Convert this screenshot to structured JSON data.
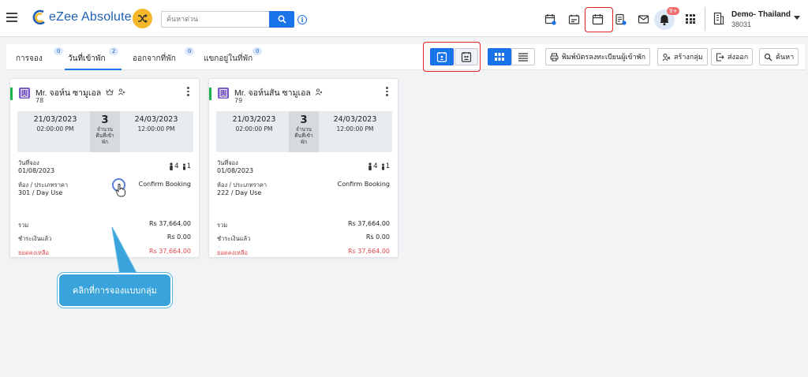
{
  "app": {
    "logo_text": "eZee Absolute"
  },
  "search": {
    "placeholder": "ค้นหาด่วน"
  },
  "notifications": {
    "badge": "9+"
  },
  "property": {
    "name": "Demo- Thailand",
    "code": "38031"
  },
  "tabs": [
    {
      "label": "การจอง",
      "count": "0"
    },
    {
      "label": "วันที่เข้าพัก",
      "count": "2"
    },
    {
      "label": "ออกจากที่พัก",
      "count": "0"
    },
    {
      "label": "แขกอยู่ในที่พัก",
      "count": "0"
    }
  ],
  "toolbar": {
    "print_registration": "พิมพ์บัตรลงทะเบียนผู้เข้าพัก",
    "create_group": "สร้างกลุ่ม",
    "export": "ส่งออก",
    "search": "ค้นหา"
  },
  "cards": [
    {
      "guest": "Mr. จอห์น ซามูเอล",
      "id": "78",
      "arrival_date": "21/03/2023",
      "arrival_time": "02:00:00 PM",
      "nights": "3",
      "nights_label_1": "จำนวน",
      "nights_label_2": "คืนที่เข้า",
      "nights_label_3": "พัก",
      "departure_date": "24/03/2023",
      "departure_time": "12:00:00 PM",
      "booking_date_label": "วันที่จอง",
      "booking_date": "01/08/2023",
      "adults": "4",
      "children": "1",
      "room_label": "ห้อง / ประเภทราคา",
      "room": "301 / Day Use",
      "status": "Confirm Booking",
      "total_label": "รวม",
      "total": "Rs 37,664.00",
      "paid_label": "ชำระเงินแล้ว",
      "paid": "Rs 0.00",
      "balance_label": "ยอดคงเหลือ",
      "balance": "Rs 37,664.00"
    },
    {
      "guest": "Mr. จอห์นสัน ซามูเอล",
      "id": "79",
      "arrival_date": "21/03/2023",
      "arrival_time": "02:00:00 PM",
      "nights": "3",
      "nights_label_1": "จำนวน",
      "nights_label_2": "คืนที่เข้า",
      "nights_label_3": "พัก",
      "departure_date": "24/03/2023",
      "departure_time": "12:00:00 PM",
      "booking_date_label": "วันที่จอง",
      "booking_date": "01/08/2023",
      "adults": "4",
      "children": "1",
      "room_label": "ห้อง / ประเภทราคา",
      "room": "222 / Day Use",
      "status": "Confirm Booking",
      "total_label": "รวม",
      "total": "Rs 37,664.00",
      "paid_label": "ชำระเงินแล้ว",
      "paid": "Rs 0.00",
      "balance_label": "ยอดคงเหลือ",
      "balance": "Rs 37,664.00"
    }
  ],
  "callout": {
    "text": "คลิกที่การจองแบบกลุ่ม"
  },
  "colors": {
    "accent": "#1a73e8",
    "highlight": "#e02525",
    "status_green": "#1fb24a",
    "callout": "#3aa3db"
  }
}
